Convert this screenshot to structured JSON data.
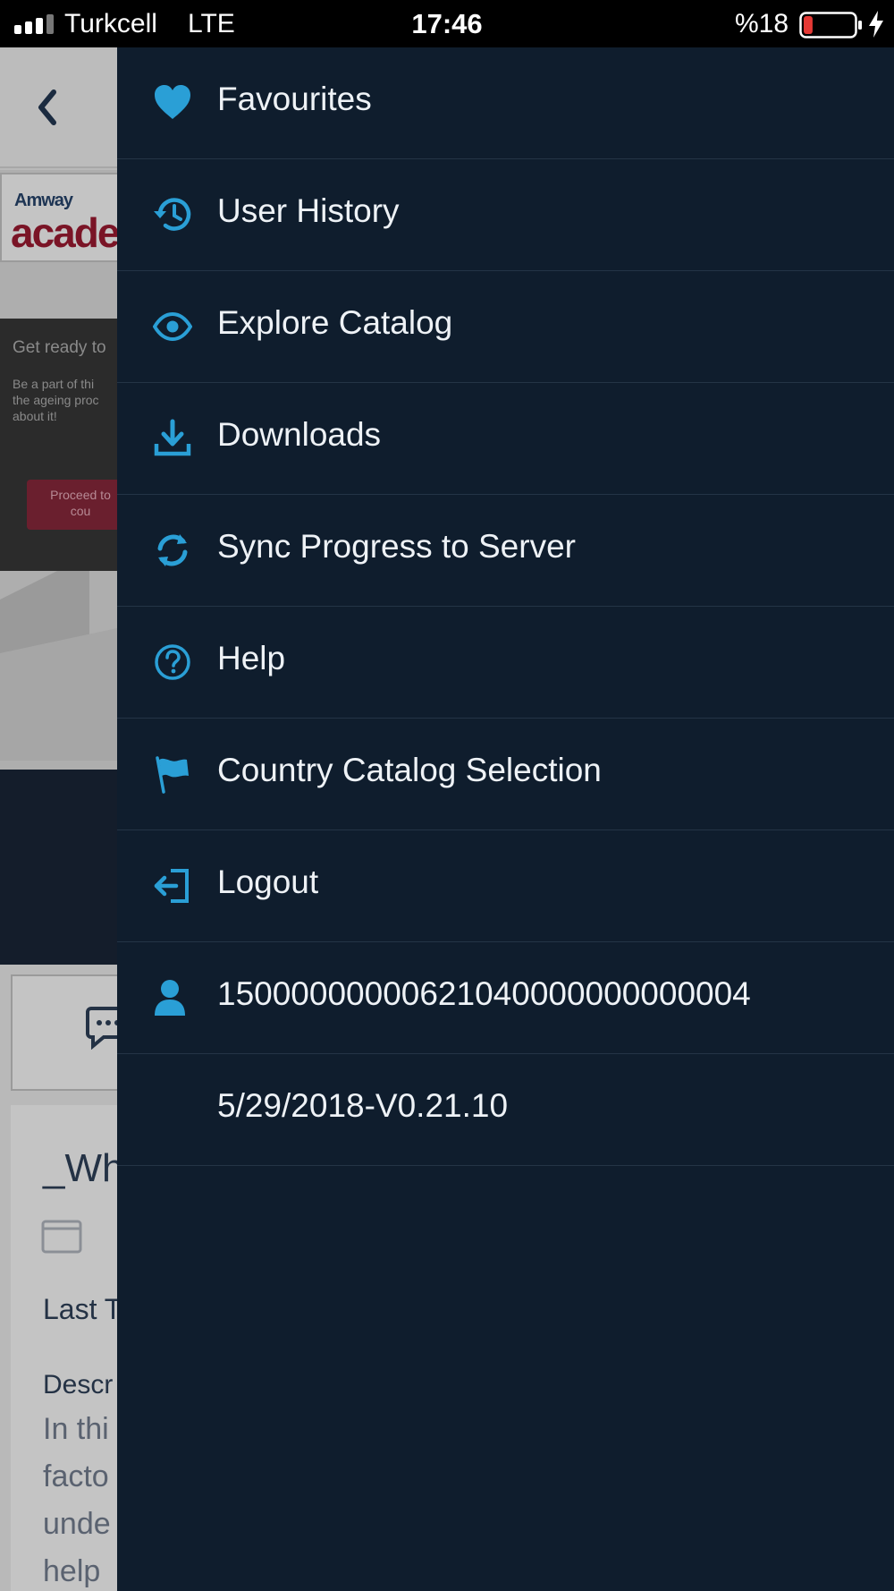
{
  "status_bar": {
    "carrier": "Turkcell",
    "network": "LTE",
    "time": "17:46",
    "battery_percent": "%18",
    "battery_level": 0.18,
    "battery_color": "#e53935"
  },
  "background": {
    "logo_small": "Amway",
    "logo_big": "acaden",
    "promo_title": "Get ready to",
    "promo_text": "Be a part of thi\nthe ageing proc\nabout it!",
    "promo_button": "Proceed to\ncou",
    "heading": "_Why",
    "last_label": "Last T",
    "description_label": "Descr",
    "description_text": "In thi\nfacto\nunde\nhelp"
  },
  "drawer": {
    "accent_color": "#2a9fd6",
    "items": [
      {
        "label": "Favourites",
        "icon": "heart-icon"
      },
      {
        "label": "User History",
        "icon": "history-icon"
      },
      {
        "label": "Explore Catalog",
        "icon": "eye-icon"
      },
      {
        "label": "Downloads",
        "icon": "download-icon"
      },
      {
        "label": "Sync Progress to Server",
        "icon": "sync-icon"
      },
      {
        "label": "Help",
        "icon": "help-icon"
      },
      {
        "label": "Country Catalog Selection",
        "icon": "flag-icon"
      },
      {
        "label": "Logout",
        "icon": "logout-icon"
      },
      {
        "label": "15000000000621040000000000004",
        "icon": "user-icon"
      },
      {
        "label": "5/29/2018-V0.21.10",
        "icon": ""
      }
    ]
  }
}
